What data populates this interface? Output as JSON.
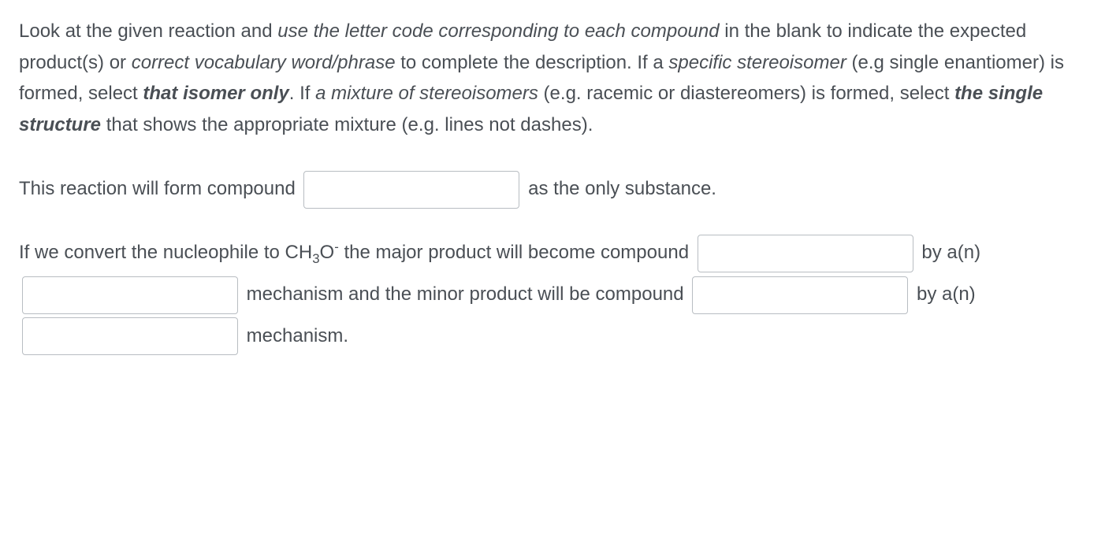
{
  "instructions": {
    "part1": "Look at the given reaction and ",
    "part2_italic": "use the letter code corresponding to each compound",
    "part3": " in the blank to indicate the expected product(s) or ",
    "part4_italic": "correct vocabulary word/phrase",
    "part5": " to complete the description. If a ",
    "part6_italic": "specific stereoisomer",
    "part7": " (e.g single enantiomer) is formed, select ",
    "part8_bolditalic": "that isomer only",
    "part9": ". If ",
    "part10_italic": "a mixture of stereoisomers",
    "part11": " (e.g. racemic or diastereomers) is formed, select ",
    "part12_bolditalic": "the single structure",
    "part13": " that shows the appropriate mixture (e.g. lines not dashes)."
  },
  "q1": {
    "before": "This reaction will form compound ",
    "after": " as the only substance."
  },
  "q2": {
    "line1_before": "If we convert the nucleophile to CH",
    "line1_sub": "3",
    "line1_after_sub": "O",
    "line1_sup": "-",
    "line1_rest": " the major product will become compound ",
    "by_an_1": " by a(n) ",
    "mech_and_minor": " mechanism and the minor product will be compound ",
    "by_an_2": " by a(n) ",
    "mech_end": " mechanism."
  }
}
